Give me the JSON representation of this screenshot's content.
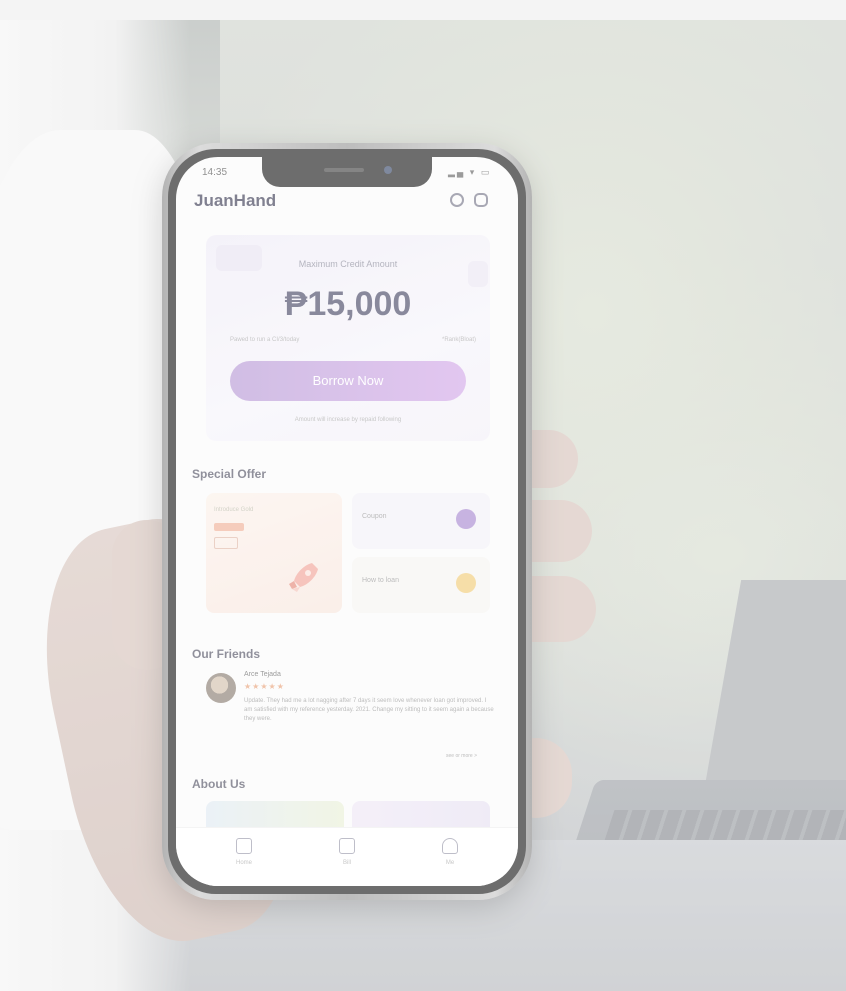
{
  "status_bar": {
    "time": "14:35",
    "icons": "▂▄ ▾ ▭"
  },
  "app": {
    "title": "JuanHand",
    "header_icons": [
      "headset-icon",
      "message-icon"
    ]
  },
  "credit": {
    "label": "Maximum Credit Amount",
    "amount": "₱15,000",
    "note_left": "Pawed to run a CI/3/today",
    "note_right": "*Rank(Bloat)",
    "button_label": "Borrow Now",
    "hint": "Amount will increase by repaid following"
  },
  "special_offer": {
    "title": "Special Offer",
    "big_card_title": "Introduce Gold",
    "coupon_label": "Coupon",
    "howto_label": "How to loan"
  },
  "friends": {
    "title": "Our Friends",
    "name": "Arce Tejada",
    "stars": "★★★★★",
    "review": "Update. They had me a lot nagging after 7 days it seem love whenever loan got improved. I am satisfied with my reference yesterday. 2021. Change my sitting to it seem again a because they were.",
    "see_more": "see or more >"
  },
  "about": {
    "title": "About Us"
  },
  "tabs": [
    {
      "label": "Home",
      "icon": "home-icon"
    },
    {
      "label": "Bill",
      "icon": "bill-icon"
    },
    {
      "label": "Me",
      "icon": "profile-icon"
    }
  ]
}
